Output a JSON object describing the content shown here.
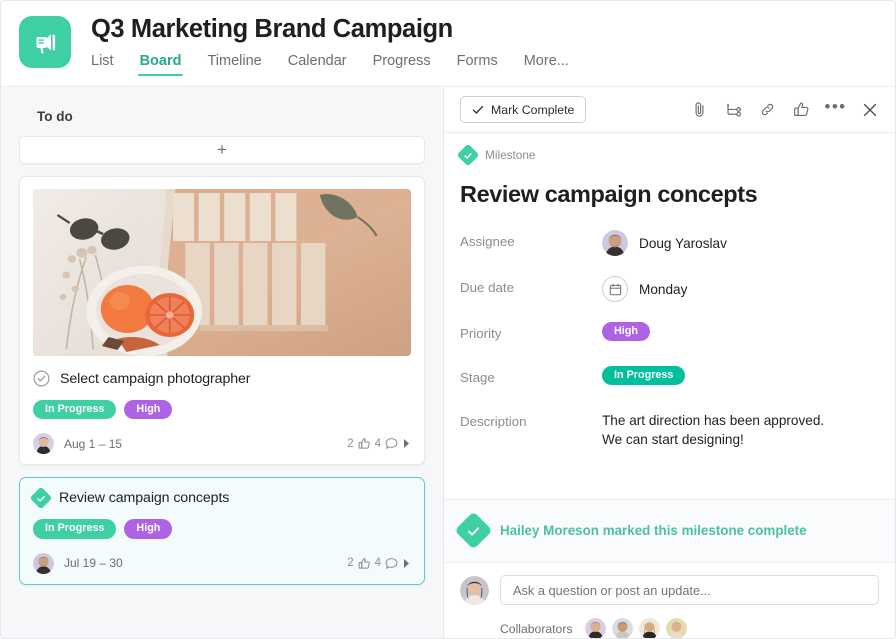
{
  "header": {
    "logo_icon": "megaphone-icon",
    "project_title": "Q3 Marketing Brand Campaign",
    "tabs": [
      {
        "label": "List",
        "active": false
      },
      {
        "label": "Board",
        "active": true
      },
      {
        "label": "Timeline",
        "active": false
      },
      {
        "label": "Calendar",
        "active": false
      },
      {
        "label": "Progress",
        "active": false
      },
      {
        "label": "Forms",
        "active": false
      },
      {
        "label": "More...",
        "active": false
      }
    ]
  },
  "board": {
    "column_title": "To do",
    "add_card_label": "+",
    "cards": [
      {
        "title": "Select campaign photographer",
        "marker": "check-circle-icon",
        "has_thumbnail": true,
        "badges": [
          {
            "label": "In Progress",
            "color": "#3fcfa4"
          },
          {
            "label": "High",
            "color": "#ae63e4"
          }
        ],
        "date": "Aug 1 – 15",
        "likes": "2",
        "comments": "4",
        "selected": false
      },
      {
        "title": "Review campaign concepts",
        "marker": "milestone-diamond-icon",
        "has_thumbnail": false,
        "badges": [
          {
            "label": "In Progress",
            "color": "#3fcfa4"
          },
          {
            "label": "High",
            "color": "#ae63e4"
          }
        ],
        "date": "Jul 19 – 30",
        "likes": "2",
        "comments": "4",
        "selected": true
      }
    ]
  },
  "detail": {
    "mark_complete_label": "Mark Complete",
    "toolbar_icons": [
      "attachment-icon",
      "subtask-icon",
      "link-icon",
      "thumbs-up-icon",
      "more-options-icon",
      "close-icon"
    ],
    "type_label": "Milestone",
    "title": "Review campaign concepts",
    "fields": [
      {
        "label": "Assignee",
        "value": "Doug Yaroslav",
        "kind": "person"
      },
      {
        "label": "Due date",
        "value": "Monday",
        "kind": "date"
      },
      {
        "label": "Priority",
        "value": "High",
        "kind": "badge",
        "color": "#ae63e4"
      },
      {
        "label": "Stage",
        "value": "In Progress",
        "kind": "badge",
        "color": "#00bf9c"
      },
      {
        "label": "Description",
        "value": "The art direction has been approved.\nWe can start designing!",
        "kind": "text"
      }
    ],
    "activity": {
      "icon": "milestone-complete-icon",
      "text": "Hailey Moreson marked this milestone complete",
      "color": "#4cc0a4"
    },
    "comment": {
      "placeholder": "Ask a question or post an update...",
      "value": ""
    },
    "collaborators_label": "Collaborators",
    "collaborator_count": 4
  },
  "colors": {
    "brand_teal": "#3fcfa4",
    "priority_purple": "#ae63e4",
    "selected_border": "#62c9d3",
    "board_bg": "#f6f7f9"
  }
}
